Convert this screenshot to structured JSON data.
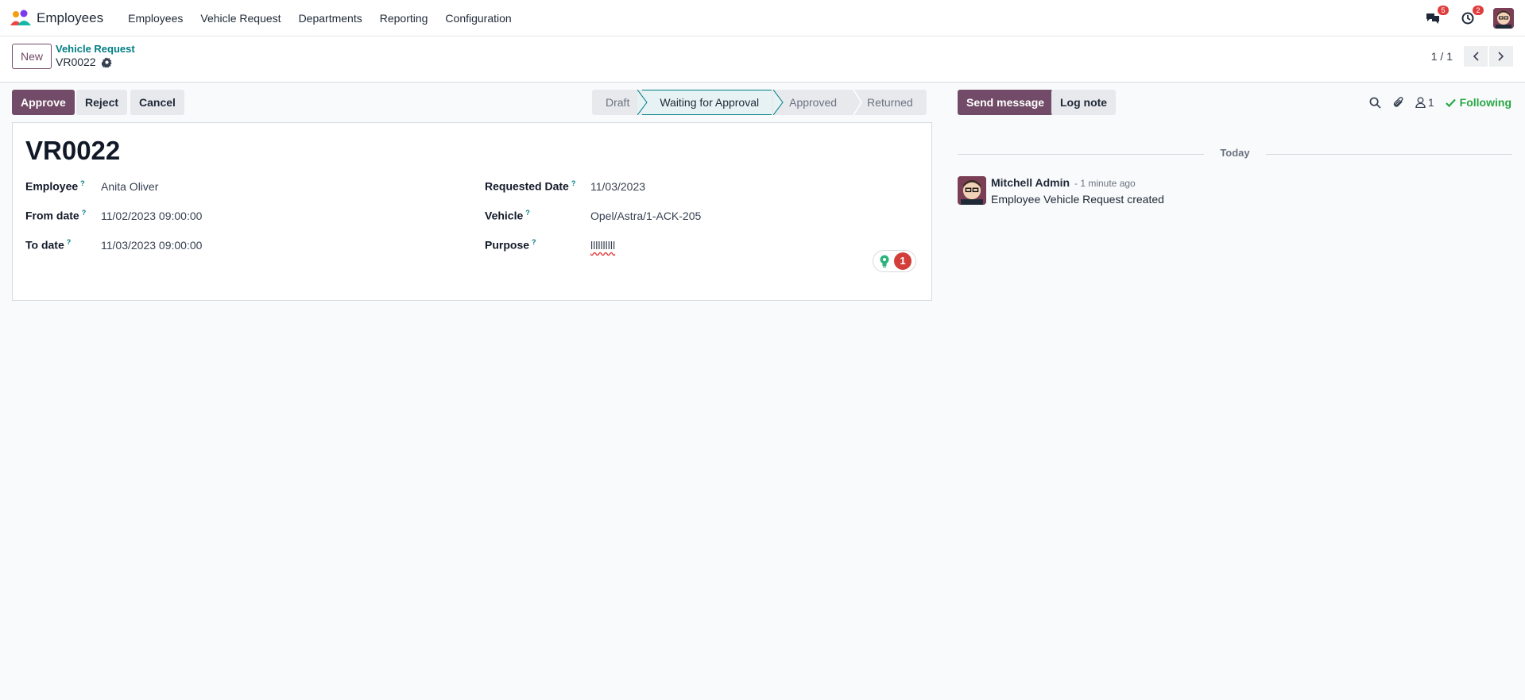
{
  "app": {
    "name": "Employees",
    "menu": [
      "Employees",
      "Vehicle Request",
      "Departments",
      "Reporting",
      "Configuration"
    ]
  },
  "systray": {
    "messages_count": "5",
    "activities_count": "2"
  },
  "control_panel": {
    "new_label": "New",
    "breadcrumb_parent": "Vehicle Request",
    "breadcrumb_current": "VR0022",
    "pager_value": "1 / 1"
  },
  "actions": {
    "approve": "Approve",
    "reject": "Reject",
    "cancel": "Cancel"
  },
  "statusbar": {
    "stages": [
      "Draft",
      "Waiting for Approval",
      "Approved",
      "Returned"
    ],
    "active": "Waiting for Approval"
  },
  "form": {
    "title": "VR0022",
    "help_mark": "?",
    "fields": {
      "employee": {
        "label": "Employee",
        "value": "Anita Oliver"
      },
      "from_date": {
        "label": "From date",
        "value": "11/02/2023 09:00:00"
      },
      "to_date": {
        "label": "To date",
        "value": "11/03/2023 09:00:00"
      },
      "requested_date": {
        "label": "Requested Date",
        "value": "11/03/2023"
      },
      "vehicle": {
        "label": "Vehicle",
        "value": "Opel/Astra/1-ACK-205"
      },
      "purpose": {
        "label": "Purpose",
        "value": "llllllllll"
      }
    },
    "suggestion_count": "1"
  },
  "chatter": {
    "send_message": "Send message",
    "log_note": "Log note",
    "followers_count": "1",
    "following_label": "Following",
    "day_label": "Today",
    "message": {
      "author": "Mitchell Admin",
      "date": "- 1 minute ago",
      "body": "Employee Vehicle Request created"
    }
  },
  "colors": {
    "brand": "#714b67",
    "link": "#017e84",
    "badge": "#e03e3e",
    "following": "#28a745"
  }
}
